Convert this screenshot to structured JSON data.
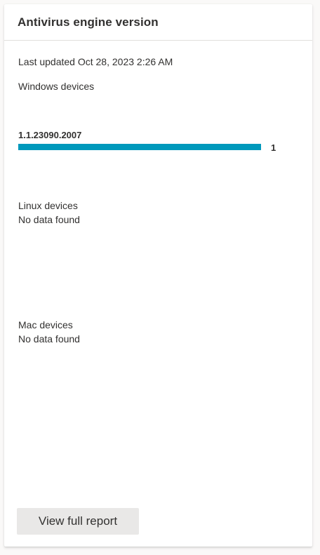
{
  "card": {
    "title": "Antivirus engine version",
    "last_updated": "Last updated Oct 28, 2023 2:26 AM"
  },
  "windows": {
    "label": "Windows devices",
    "bars": [
      {
        "version": "1.1.23090.2007",
        "count": "1",
        "fraction": 1.0
      }
    ],
    "bar_color": "#0099bc"
  },
  "linux": {
    "label": "Linux devices",
    "status": "No data found"
  },
  "mac": {
    "label": "Mac devices",
    "status": "No data found"
  },
  "actions": {
    "view_report_label": "View full report"
  }
}
